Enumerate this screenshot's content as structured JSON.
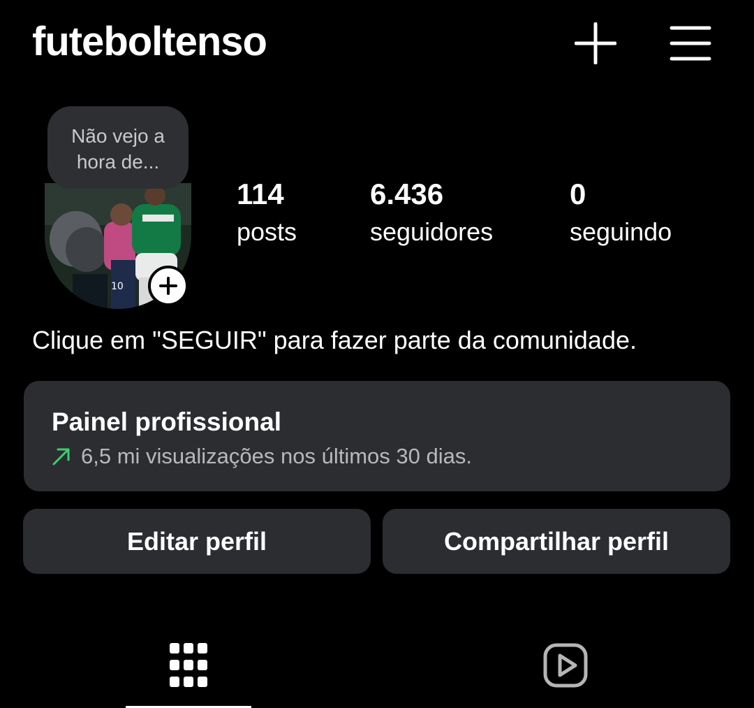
{
  "header": {
    "username": "futeboltenso",
    "icons": {
      "create": "plus-icon",
      "menu": "hamburger-menu-icon"
    }
  },
  "note": {
    "line1": "Não vejo a",
    "line2": "hora de..."
  },
  "stats": [
    {
      "value": "114",
      "label": "posts"
    },
    {
      "value": "6.436",
      "label": "seguidores"
    },
    {
      "value": "0",
      "label": "seguindo"
    }
  ],
  "bio": "Clique em \"SEGUIR\" para fazer parte da comunidade.",
  "dashboard": {
    "title": "Painel profissional",
    "subtitle": "6,5 mi visualizações nos últimos 30 dias.",
    "trend_color": "#3ecf6a"
  },
  "actions": {
    "edit": "Editar perfil",
    "share": "Compartilhar perfil"
  },
  "tabs": {
    "icons": [
      "grid-icon",
      "reels-icon"
    ],
    "active": "grid-icon"
  },
  "colors": {
    "background": "#000000",
    "surface": "#2b2d31",
    "text": "#ffffff",
    "muted": "#b9b9b9"
  }
}
